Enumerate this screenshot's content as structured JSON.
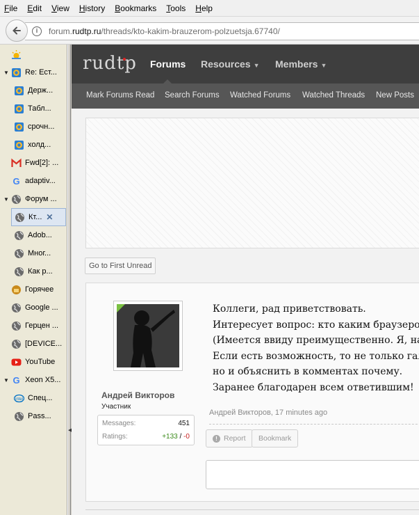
{
  "menubar": {
    "items": [
      {
        "label": "File",
        "accel": "F",
        "rest": "ile"
      },
      {
        "label": "Edit",
        "accel": "E",
        "rest": "dit"
      },
      {
        "label": "View",
        "accel": "V",
        "rest": "iew"
      },
      {
        "label": "History",
        "accel": "H",
        "rest": "istory"
      },
      {
        "label": "Bookmarks",
        "accel": "B",
        "rest": "ookmarks"
      },
      {
        "label": "Tools",
        "accel": "T",
        "rest": "ools"
      },
      {
        "label": "Help",
        "accel": "H",
        "rest": "elp"
      }
    ]
  },
  "address": {
    "prefix": "forum.",
    "domain": "rudtp.ru",
    "path": "/threads/kto-kakim-brauzerom-polzuetsja.67740/"
  },
  "sidebar": {
    "tabs": [
      {
        "label": "",
        "icon": "sun-icon",
        "twisty": ""
      },
      {
        "label": "Re: Ест...",
        "icon": "thunderbird-icon",
        "twisty": "▼"
      },
      {
        "label": "Держ...",
        "icon": "thunderbird-icon",
        "twisty": ""
      },
      {
        "label": "Табл...",
        "icon": "thunderbird-icon",
        "twisty": ""
      },
      {
        "label": "срочн...",
        "icon": "thunderbird-icon",
        "twisty": ""
      },
      {
        "label": "холд...",
        "icon": "thunderbird-icon",
        "twisty": ""
      },
      {
        "label": "Fwd[2]: ...",
        "icon": "gmail-icon",
        "twisty": ""
      },
      {
        "label": "adaptiv...",
        "icon": "google-icon",
        "twisty": ""
      },
      {
        "label": "Форум ...",
        "icon": "globe-icon",
        "twisty": "▼"
      },
      {
        "label": "Кт...",
        "icon": "globe-icon",
        "twisty": "",
        "active": true
      },
      {
        "label": "Adob...",
        "icon": "globe-icon",
        "twisty": ""
      },
      {
        "label": "Мног...",
        "icon": "globe-icon",
        "twisty": ""
      },
      {
        "label": "Как р...",
        "icon": "globe-icon",
        "twisty": ""
      },
      {
        "label": "Горячее",
        "icon": "box-icon",
        "twisty": ""
      },
      {
        "label": "Google ...",
        "icon": "globe-icon",
        "twisty": ""
      },
      {
        "label": "Герцен ...",
        "icon": "globe-icon",
        "twisty": ""
      },
      {
        "label": "[DEVICE...",
        "icon": "globe-icon",
        "twisty": ""
      },
      {
        "label": "YouTube",
        "icon": "youtube-icon",
        "twisty": ""
      },
      {
        "label": "Xeon X5...",
        "icon": "google-icon",
        "twisty": "▼"
      },
      {
        "label": "Спец...",
        "icon": "intel-icon",
        "twisty": ""
      },
      {
        "label": "Pass...",
        "icon": "globe-icon",
        "twisty": ""
      }
    ],
    "close_glyph": "✕"
  },
  "site": {
    "logo": "rudtp",
    "nav": {
      "forums": "Forums",
      "resources": "Resources",
      "members": "Members",
      "caret": "▼"
    },
    "subnav": {
      "mark_read": "Mark Forums Read",
      "search": "Search Forums",
      "watched_forums": "Watched Forums",
      "watched_threads": "Watched Threads",
      "new_posts": "New Posts"
    },
    "first_unread": "Go to First Unread"
  },
  "post": {
    "author": "Андрей Викторов",
    "role": "Участник",
    "stats": {
      "messages_label": "Messages:",
      "messages_value": "451",
      "ratings_label": "Ratings:",
      "ratings_pos": "+133",
      "ratings_sep": " / ",
      "ratings_neg": "-0"
    },
    "lines": [
      "Коллеги, рад приветствовать.",
      "Интересует вопрос: кто каким браузером пользуется?",
      "(Имеется ввиду преимущественно. Я, например — Firefox)",
      "Если есть возможность, то не только галочку поставить,",
      "но и объяснить в комментах почему.",
      "Заранее благодарен всем ответившим!"
    ],
    "meta": "Андрей Викторов, 17 minutes ago",
    "report": "Report",
    "bookmark": "Bookmark"
  },
  "colors": {
    "nav_bg": "#3e3e3e",
    "subnav_bg": "#565656",
    "rating_positive": "#3a8a1a",
    "rating_negative": "#c62020",
    "new_badge": "#7bc043"
  }
}
